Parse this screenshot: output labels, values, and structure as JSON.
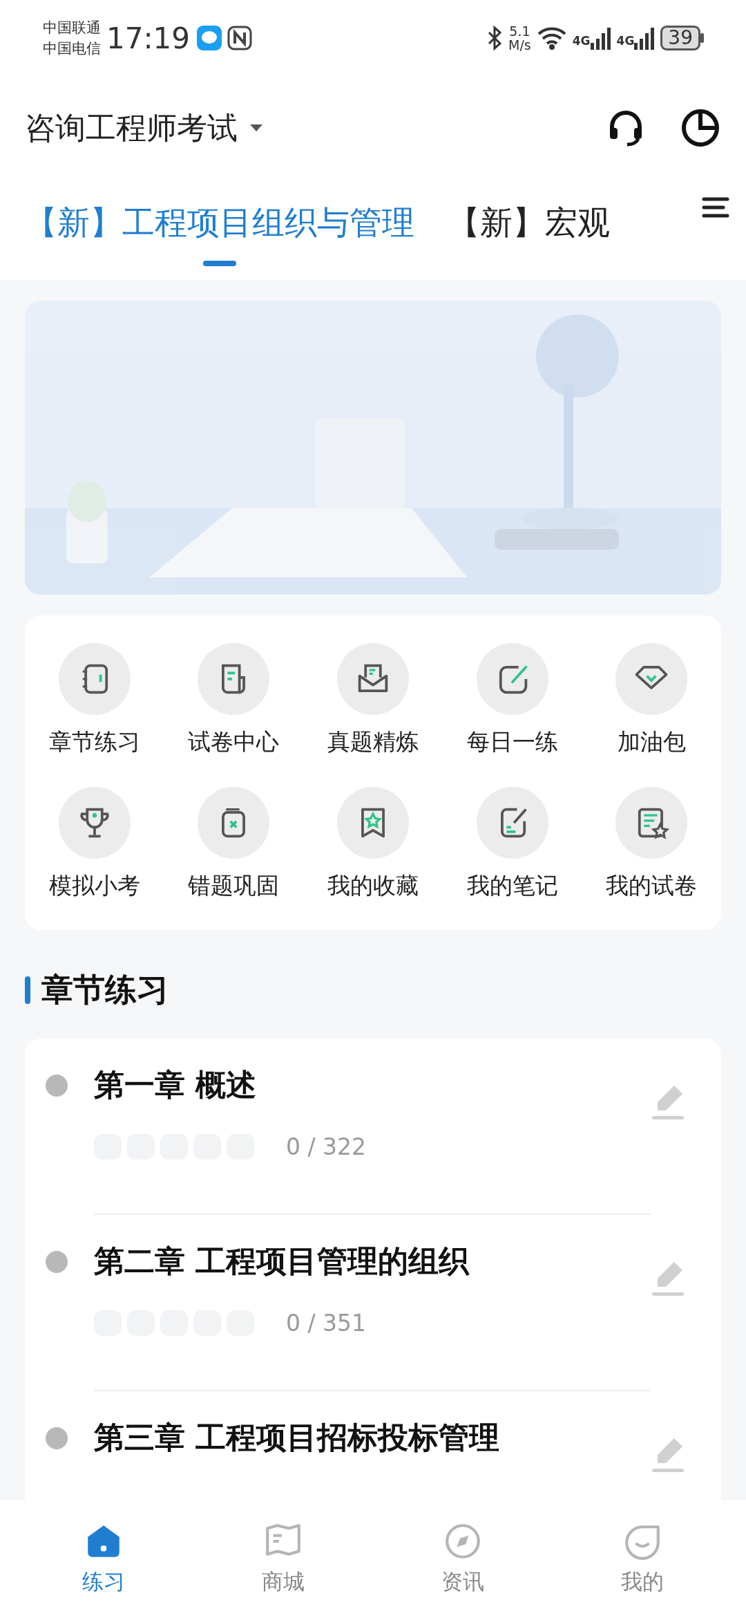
{
  "status_bar": {
    "carriers": [
      "中国联通",
      "中国电信"
    ],
    "time": "17:19",
    "speed_value": "5.1",
    "speed_unit": "M/s",
    "networks": [
      "4G",
      "4G"
    ],
    "battery": "39"
  },
  "header": {
    "title": "咨询工程师考试"
  },
  "tabs": [
    {
      "label": "【新】工程项目组织与管理",
      "selected": true
    },
    {
      "label": "【新】宏观",
      "selected": false
    }
  ],
  "shortcuts": [
    {
      "label": "章节练习"
    },
    {
      "label": "试卷中心"
    },
    {
      "label": "真题精炼"
    },
    {
      "label": "每日一练"
    },
    {
      "label": "加油包"
    },
    {
      "label": "模拟小考"
    },
    {
      "label": "错题巩固"
    },
    {
      "label": "我的收藏"
    },
    {
      "label": "我的笔记"
    },
    {
      "label": "我的试卷"
    }
  ],
  "section": {
    "title": "章节练习"
  },
  "chapters": [
    {
      "title": "第一章 概述",
      "level": 0,
      "count": "0 / 322"
    },
    {
      "title": "第二章 工程项目管理的组织",
      "level": 0,
      "count": "0 / 351"
    },
    {
      "title": "第三章 工程项目招标投标管理"
    }
  ],
  "bottom_nav": [
    {
      "label": "练习",
      "selected": true
    },
    {
      "label": "商城",
      "selected": false
    },
    {
      "label": "资讯",
      "selected": false
    },
    {
      "label": "我的",
      "selected": false
    }
  ]
}
